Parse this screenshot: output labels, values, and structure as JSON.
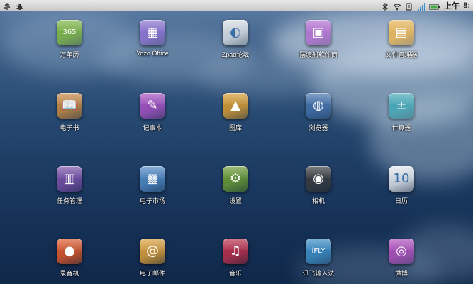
{
  "status_bar": {
    "time_prefix": "上午",
    "time": "8:",
    "left_icons": [
      "usb-icon",
      "debug-bug-icon"
    ],
    "right_icons": [
      "bluetooth-icon",
      "wifi-icon",
      "sync-icon",
      "signal-icon",
      "battery-icon"
    ]
  },
  "apps": [
    {
      "label": "万年历",
      "icon": "calendar-365-icon",
      "color": "#7bb33a",
      "glyph": "365"
    },
    {
      "label": "Yozo Office",
      "icon": "office-icon",
      "color": "#8c6fd1",
      "glyph": "▦"
    },
    {
      "label": "Zpad论坛",
      "icon": "forum-icon",
      "color": "#d9dde2",
      "glyph": "◐"
    },
    {
      "label": "摆渡船软件商",
      "icon": "store-bag-icon",
      "color": "#b36ad0",
      "glyph": "▣"
    },
    {
      "label": "文件管理器",
      "icon": "folder-search-icon",
      "color": "#e8b24c",
      "glyph": "▤"
    },
    {
      "label": "电子书",
      "icon": "ebook-icon",
      "color": "#c9883e",
      "glyph": "📖"
    },
    {
      "label": "记事本",
      "icon": "notepad-icon",
      "color": "#a84fc2",
      "glyph": "✎"
    },
    {
      "label": "图库",
      "icon": "gallery-icon",
      "color": "#d99b2c",
      "glyph": "▲"
    },
    {
      "label": "浏览器",
      "icon": "browser-globe-icon",
      "color": "#3f6ea8",
      "glyph": "◍"
    },
    {
      "label": "计算器",
      "icon": "calculator-icon",
      "color": "#3fa7b5",
      "glyph": "±"
    },
    {
      "label": "任务管理",
      "icon": "task-manager-icon",
      "color": "#7a4fa8",
      "glyph": "▥"
    },
    {
      "label": "电子市场",
      "icon": "market-icon",
      "color": "#4f88c4",
      "glyph": "▩"
    },
    {
      "label": "设置",
      "icon": "settings-gear-icon",
      "color": "#6a9c2f",
      "glyph": "⚙"
    },
    {
      "label": "相机",
      "icon": "camera-icon",
      "color": "#3a3a3a",
      "glyph": "◉"
    },
    {
      "label": "日历",
      "icon": "calendar-icon",
      "color": "#e3e7ec",
      "glyph": "10"
    },
    {
      "label": "录音机",
      "icon": "recorder-mic-icon",
      "color": "#e35a2a",
      "glyph": "●"
    },
    {
      "label": "电子邮件",
      "icon": "email-icon",
      "color": "#e0a23a",
      "glyph": "@"
    },
    {
      "label": "音乐",
      "icon": "music-headphones-icon",
      "color": "#c0304a",
      "glyph": "♫"
    },
    {
      "label": "讯飞输入法",
      "icon": "ifly-input-icon",
      "color": "#3a8fc9",
      "glyph": "iFLY"
    },
    {
      "label": "微博",
      "icon": "weibo-icon",
      "color": "#b44fc0",
      "glyph": "◎"
    }
  ]
}
